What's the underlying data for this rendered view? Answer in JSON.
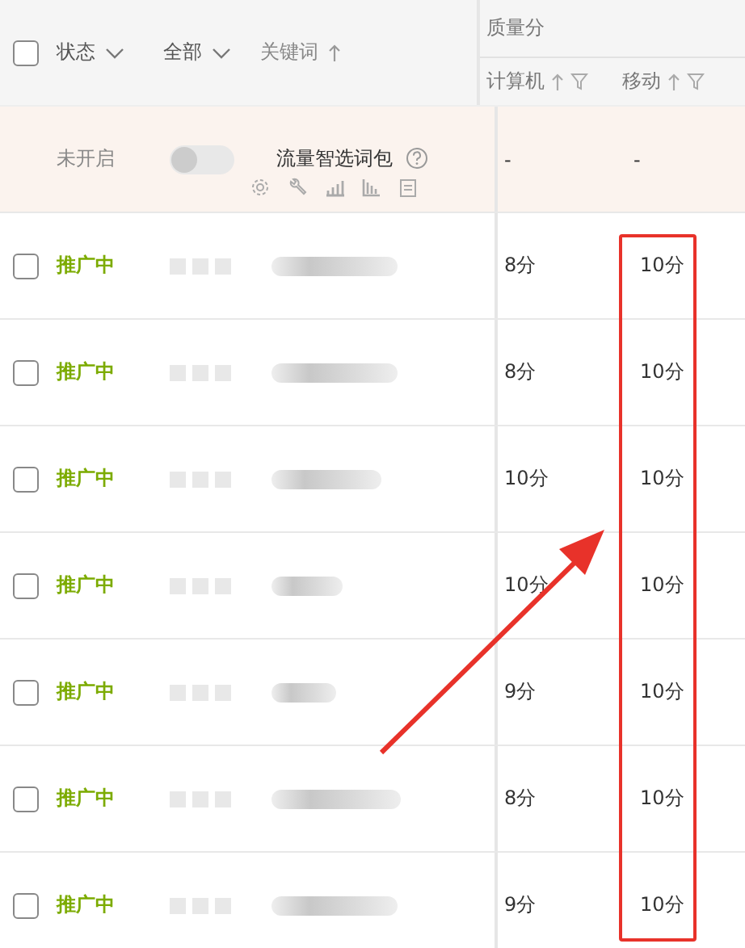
{
  "header": {
    "checked": false,
    "columns": [
      {
        "label": "状态",
        "kind": "dropdown"
      },
      {
        "label": "全部",
        "kind": "dropdown"
      },
      {
        "label": "关键词",
        "kind": "sort"
      }
    ],
    "group": "质量分",
    "subcolumns": [
      {
        "label": "计算机"
      },
      {
        "label": "移动"
      }
    ]
  },
  "special_row": {
    "status": "未开启",
    "on": false,
    "name": "流量智选词包",
    "pc": "-",
    "mobile": "-"
  },
  "rows": [
    {
      "checked": false,
      "status": "推广中",
      "pc": "8分",
      "mobile": "10分"
    },
    {
      "checked": false,
      "status": "推广中",
      "pc": "8分",
      "mobile": "10分"
    },
    {
      "checked": false,
      "status": "推广中",
      "pc": "10分",
      "mobile": "10分"
    },
    {
      "checked": false,
      "status": "推广中",
      "pc": "10分",
      "mobile": "10分"
    },
    {
      "checked": false,
      "status": "推广中",
      "pc": "9分",
      "mobile": "10分"
    },
    {
      "checked": false,
      "status": "推广中",
      "pc": "8分",
      "mobile": "10分"
    },
    {
      "checked": false,
      "status": "推广中",
      "pc": "9分",
      "mobile": "10分"
    }
  ],
  "annotations": {
    "box": true,
    "arrow": true
  }
}
